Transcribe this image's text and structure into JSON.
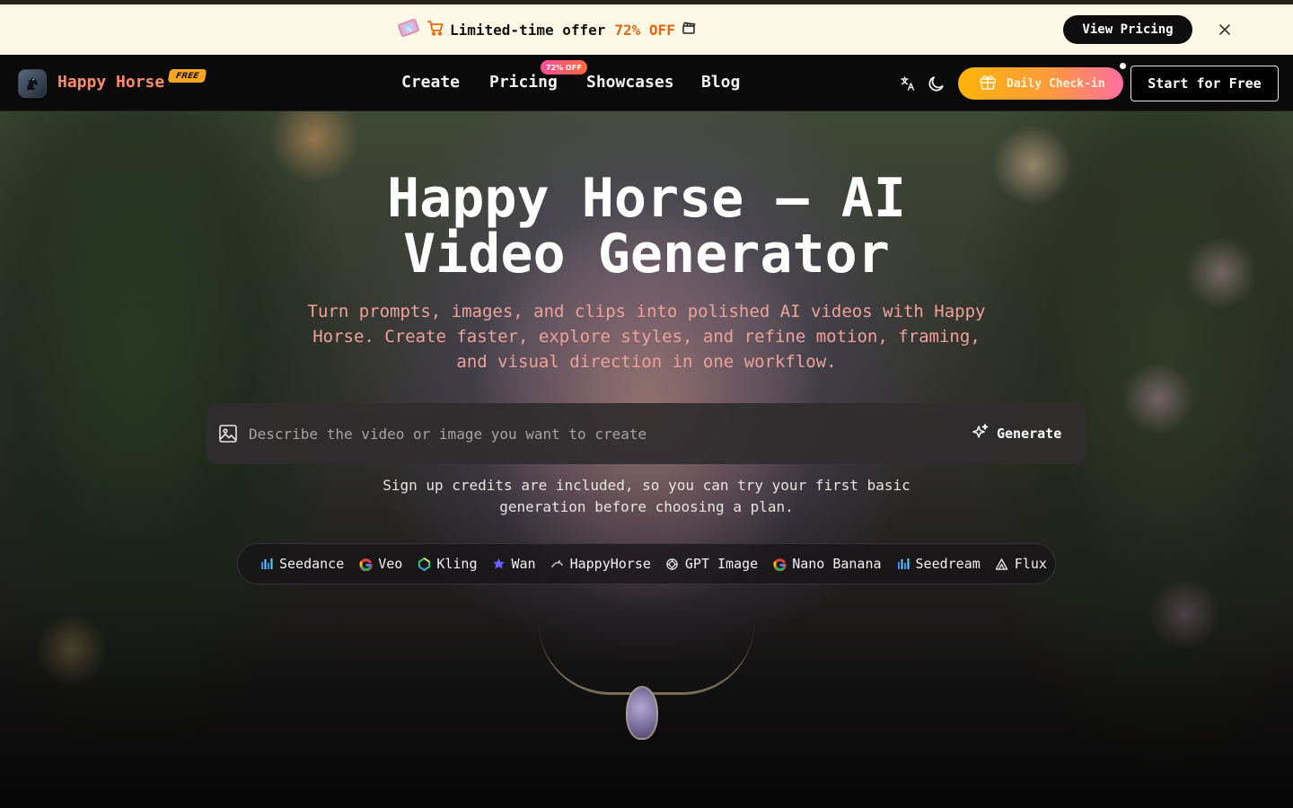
{
  "promo": {
    "text": "Limited-time offer",
    "discount": "72% OFF",
    "button_label": "View Pricing"
  },
  "header": {
    "brand": "Happy Horse",
    "brand_badge": "FREE",
    "nav": [
      {
        "label": "Create"
      },
      {
        "label": "Pricing",
        "badge": "72% OFF"
      },
      {
        "label": "Showcases"
      },
      {
        "label": "Blog"
      }
    ],
    "checkin_label": "Daily Check-in",
    "start_label": "Start for Free"
  },
  "hero": {
    "title_line1": "Happy Horse — AI",
    "title_line2": "Video Generator",
    "subtitle": "Turn prompts, images, and clips into polished AI videos with Happy Horse. Create faster, explore styles, and refine motion, framing, and visual direction in one workflow.",
    "prompt_placeholder": "Describe the video or image you want to create",
    "generate_label": "Generate",
    "note": "Sign up credits are included, so you can try your first basic generation before choosing a plan."
  },
  "models": [
    {
      "label": "Seedance",
      "icon": "bar-chart-icon"
    },
    {
      "label": "Veo",
      "icon": "google-icon"
    },
    {
      "label": "Kling",
      "icon": "kling-icon"
    },
    {
      "label": "Wan",
      "icon": "wan-icon"
    },
    {
      "label": "HappyHorse",
      "icon": "horse-icon"
    },
    {
      "label": "GPT Image",
      "icon": "openai-icon"
    },
    {
      "label": "Nano Banana",
      "icon": "google-icon"
    },
    {
      "label": "Seedream",
      "icon": "bar-chart-icon"
    },
    {
      "label": "Flux",
      "icon": "flux-icon"
    }
  ],
  "colors": {
    "accent_orange": "#e8650a",
    "brand_coral": "#ff8a6a",
    "subtitle_pink": "#f0a29a",
    "checkin_gradient_start": "#ffb40a",
    "checkin_gradient_end": "#ff6fa0"
  }
}
